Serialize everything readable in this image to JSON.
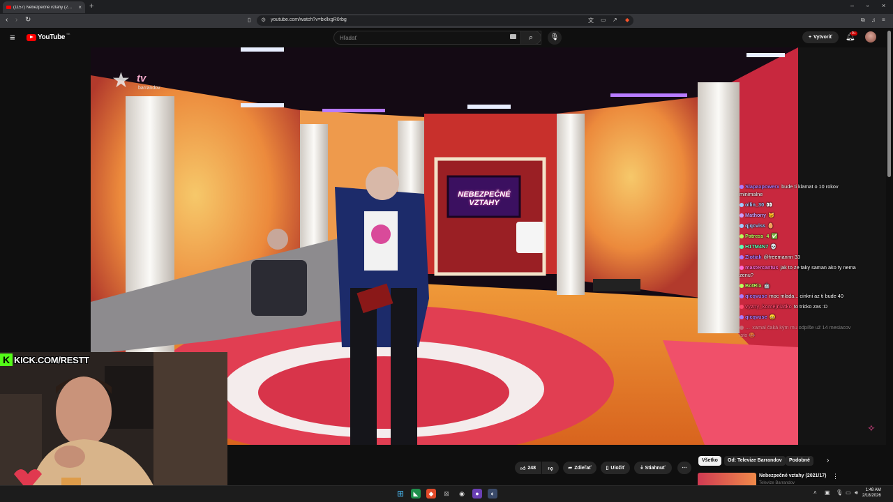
{
  "browser": {
    "tab_title": "(1157) Nebezpečné vztahy (2…",
    "url": "youtube.com/watch?v=bxllxgR0rbg",
    "new_tab": "+",
    "icons": [
      "back-icon",
      "forward-icon",
      "reload-icon",
      "bookmark-icon",
      "site-info-icon",
      "translate-icon",
      "cast-icon",
      "share-icon",
      "brave-shield-icon",
      "extensions-icon",
      "media-icon",
      "menu-icon"
    ]
  },
  "youtube": {
    "logo_text": "YouTube",
    "country_code": "SK",
    "search_placeholder": "Hľadať",
    "create_label": "Vytvoriť",
    "notification_count": "9+"
  },
  "video": {
    "channel_watermark_tv": "tv",
    "channel_watermark_name": "barrandov",
    "set_screen_title": "NEBEZPEČNÉ VZTAHY",
    "scene_colors": {
      "back_wall": "#e04a3a",
      "floor": "#e87a2a",
      "pillar": "#f2f0ec",
      "sofa": "#8d8b8e"
    }
  },
  "chat": [
    {
      "user": "Slapaxpowerx",
      "message": "bude ti klamat o 10 rokov minimalne",
      "color": "#a97bff"
    },
    {
      "user": "ollin_30",
      "message": "👀",
      "color": "#9ecbff"
    },
    {
      "user": "Mathony",
      "message": "🐱",
      "color": "#c9a0ff"
    },
    {
      "user": "qjqcviss",
      "message": "🥚",
      "color": "#9ecbff"
    },
    {
      "user": "Patress_4",
      "message": "✅",
      "color": "#b8ff5c"
    },
    {
      "user": "H1TM4N7",
      "message": "💀",
      "color": "#5cffb5"
    },
    {
      "user": "Zlotiak",
      "message": "@freemannn 33",
      "color": "#a97bff"
    },
    {
      "user": "mastercantus",
      "message": "jak to ze taky saman ako ty nema zenu?",
      "color": "#ff6bd6"
    },
    {
      "user": "BotRix",
      "message": "🤖",
      "color": "#b8ff5c"
    },
    {
      "user": "qicqvuse",
      "message": "moc mlada... cinkni az ti bude 40",
      "color": "#a97bff"
    },
    {
      "user": "vyzny_komejniatko",
      "message": "to tricko zas :D",
      "color": "#ff4a6e"
    },
    {
      "user": "qicqvuse",
      "message": "😀",
      "color": "#a97bff"
    },
    {
      "user": "…",
      "message": "xamal čaká kým mu odpíše už 14 mesiacov isto 😂",
      "color": "#bbbbbb"
    }
  ],
  "webcam": {
    "banner_k": "K",
    "banner_text": "KICK.COM/RESTT"
  },
  "actions": {
    "like_count": "248",
    "share_label": "Zdieľať",
    "save_label": "Uložiť",
    "download_label": "Stiahnuť",
    "more_label": "⋯"
  },
  "chips": [
    "Všetko",
    "Od: Televize Barrandov",
    "Podobné"
  ],
  "recommendation": {
    "title": "Nebezpečné vztahy (2021/17)",
    "channel": "Televize Barrandov"
  },
  "taskbar": {
    "time": "1:48 AM",
    "date": "2/18/2026"
  }
}
